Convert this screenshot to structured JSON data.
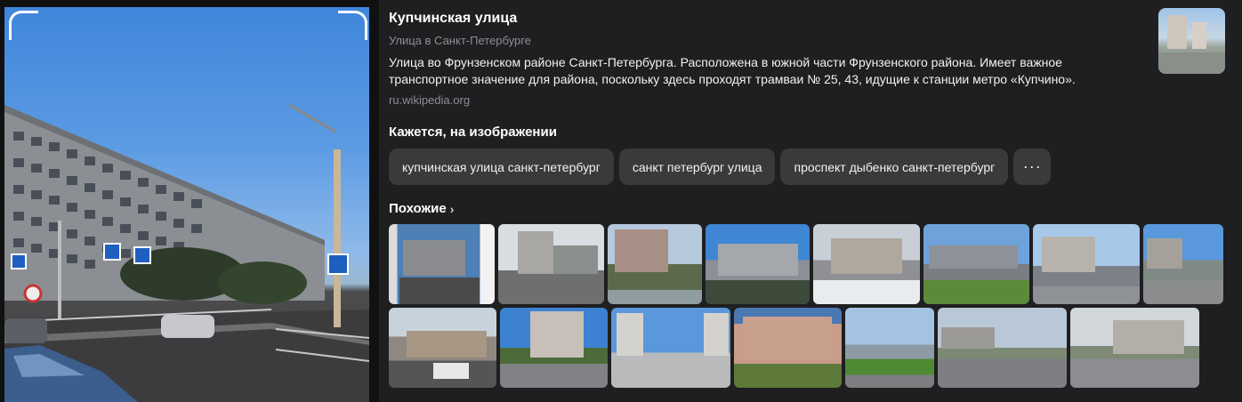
{
  "result": {
    "title": "Купчинская улица",
    "subtitle": "Улица в Санкт-Петербурге",
    "description": "Улица во Фрунзенском районе Санкт-Петербурга. Расположена в южной части Фрунзенского района. Имеет важное транспортное значение для района, поскольку здесь проходят трамваи № 25, 43, идущие к станции метро «Купчино».",
    "source": "ru.wikipedia.org"
  },
  "tags_section": {
    "heading": "Кажется, на изображении",
    "chips": [
      "купчинская улица санкт-петербург",
      "санкт петербург улица",
      "проспект дыбенко санкт-петербург"
    ],
    "more_label": "···"
  },
  "similar_section": {
    "heading": "Похожие",
    "chevron": "›"
  },
  "colors": {
    "background": "#1f1f21",
    "chip": "#3a3a3d",
    "muted_text": "#8e8e93"
  }
}
